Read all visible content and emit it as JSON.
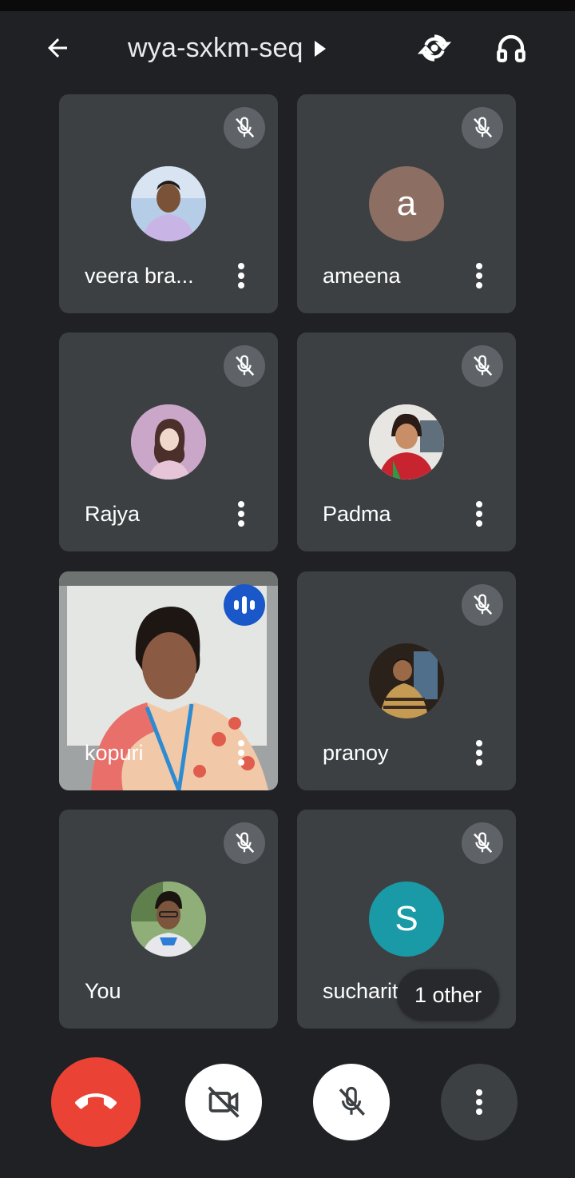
{
  "header": {
    "meeting_code": "wya-sxkm-seq",
    "icons": [
      "back-arrow-icon",
      "caret-right-icon",
      "switch-camera-icon",
      "headphones-icon"
    ]
  },
  "participants": [
    {
      "name": "veera bra...",
      "muted": true,
      "avatar": "photo"
    },
    {
      "name": "ameena",
      "muted": true,
      "avatar": "letter",
      "initial": "a",
      "avatar_color": "#8d6e63"
    },
    {
      "name": "Rajya",
      "muted": true,
      "avatar": "photo"
    },
    {
      "name": "Padma",
      "muted": true,
      "avatar": "photo"
    },
    {
      "name": "kopuri",
      "muted": false,
      "speaking": true,
      "video": true
    },
    {
      "name": "pranoy",
      "muted": true,
      "avatar": "photo"
    },
    {
      "name": "You",
      "muted": true,
      "avatar": "photo"
    },
    {
      "name": "sucharita",
      "muted": true,
      "avatar": "letter",
      "initial": "S",
      "avatar_color": "#1a9aa6"
    }
  ],
  "others_chip": "1 other",
  "controls": {
    "end_call_color": "#ea4335",
    "icons": [
      "end-call-icon",
      "camera-off-icon",
      "mic-off-icon",
      "more-options-icon"
    ]
  },
  "colors": {
    "background": "#202124",
    "tile": "#3c4043",
    "muted_badge": "#5f6368",
    "speaking_badge": "#1a57c9"
  }
}
